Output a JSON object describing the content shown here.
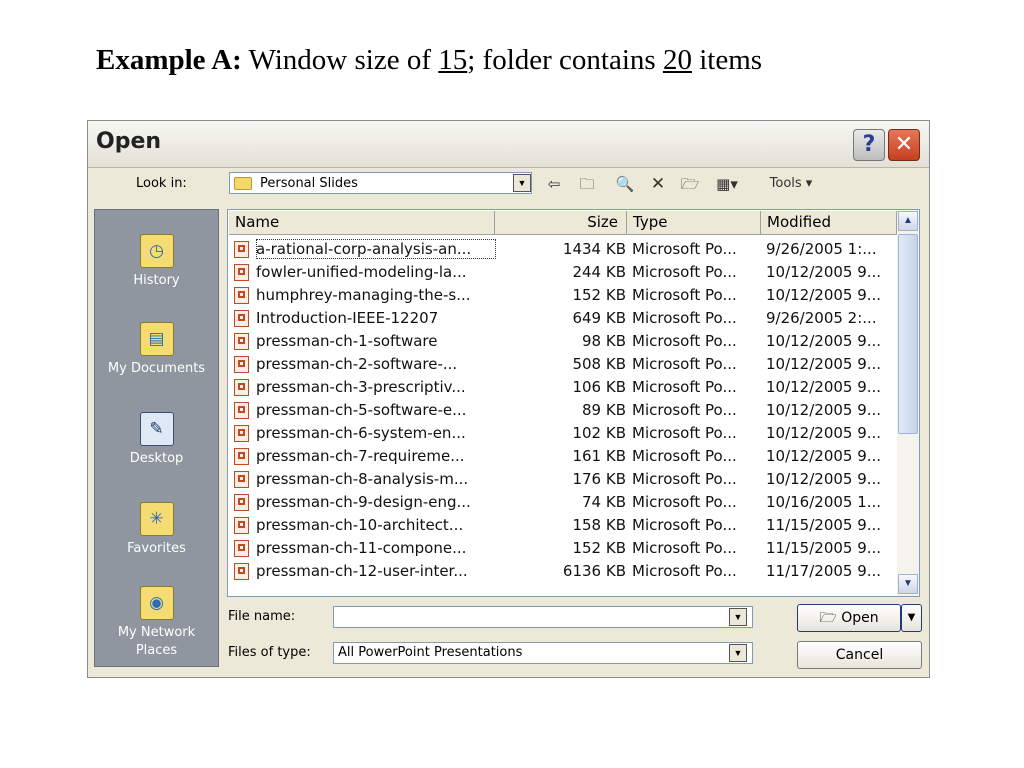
{
  "slide": {
    "title_bold": "Example A:",
    "title_part1": " Window size of  ",
    "window_size": "15",
    "title_part2": "; folder contains ",
    "item_count": "20",
    "title_part3": " items"
  },
  "dialog": {
    "title": "Open",
    "help_label": "?",
    "close_label": "✕",
    "look_in_label": "Look in:",
    "look_in_value": "Personal Slides",
    "tools_label": "Tools"
  },
  "places": [
    {
      "label": "History",
      "icon": "history-icon"
    },
    {
      "label": "My Documents",
      "icon": "my-documents-icon"
    },
    {
      "label": "Desktop",
      "icon": "desktop-icon"
    },
    {
      "label": "Favorites",
      "icon": "favorites-icon"
    },
    {
      "label": "My Network Places",
      "icon": "network-places-icon"
    }
  ],
  "columns": {
    "name": "Name",
    "size": "Size",
    "type": "Type",
    "modified": "Modified"
  },
  "files": [
    {
      "name": "a-rational-corp-analysis-an...",
      "size": "1434 KB",
      "type": "Microsoft Po...",
      "modified": "9/26/2005 1:..."
    },
    {
      "name": "fowler-unified-modeling-la...",
      "size": "244 KB",
      "type": "Microsoft Po...",
      "modified": "10/12/2005 9..."
    },
    {
      "name": "humphrey-managing-the-s...",
      "size": "152 KB",
      "type": "Microsoft Po...",
      "modified": "10/12/2005 9..."
    },
    {
      "name": "Introduction-IEEE-12207",
      "size": "649 KB",
      "type": "Microsoft Po...",
      "modified": "9/26/2005 2:..."
    },
    {
      "name": "pressman-ch-1-software",
      "size": "98 KB",
      "type": "Microsoft Po...",
      "modified": "10/12/2005 9..."
    },
    {
      "name": "pressman-ch-2-software-...",
      "size": "508 KB",
      "type": "Microsoft Po...",
      "modified": "10/12/2005 9..."
    },
    {
      "name": "pressman-ch-3-prescriptiv...",
      "size": "106 KB",
      "type": "Microsoft Po...",
      "modified": "10/12/2005 9..."
    },
    {
      "name": "pressman-ch-5-software-e...",
      "size": "89 KB",
      "type": "Microsoft Po...",
      "modified": "10/12/2005 9..."
    },
    {
      "name": "pressman-ch-6-system-en...",
      "size": "102 KB",
      "type": "Microsoft Po...",
      "modified": "10/12/2005 9..."
    },
    {
      "name": "pressman-ch-7-requireme...",
      "size": "161 KB",
      "type": "Microsoft Po...",
      "modified": "10/12/2005 9..."
    },
    {
      "name": "pressman-ch-8-analysis-m...",
      "size": "176 KB",
      "type": "Microsoft Po...",
      "modified": "10/12/2005 9..."
    },
    {
      "name": "pressman-ch-9-design-eng...",
      "size": "74 KB",
      "type": "Microsoft Po...",
      "modified": "10/16/2005 1..."
    },
    {
      "name": "pressman-ch-10-architect...",
      "size": "158 KB",
      "type": "Microsoft Po...",
      "modified": "11/15/2005 9..."
    },
    {
      "name": "pressman-ch-11-compone...",
      "size": "152 KB",
      "type": "Microsoft Po...",
      "modified": "11/15/2005 9..."
    },
    {
      "name": "pressman-ch-12-user-inter...",
      "size": "6136 KB",
      "type": "Microsoft Po...",
      "modified": "11/17/2005 9..."
    }
  ],
  "footer": {
    "file_name_label": "File name:",
    "file_name_value": "",
    "files_of_type_label": "Files of type:",
    "files_of_type_value": "All PowerPoint Presentations",
    "open_label": "Open",
    "cancel_label": "Cancel"
  }
}
